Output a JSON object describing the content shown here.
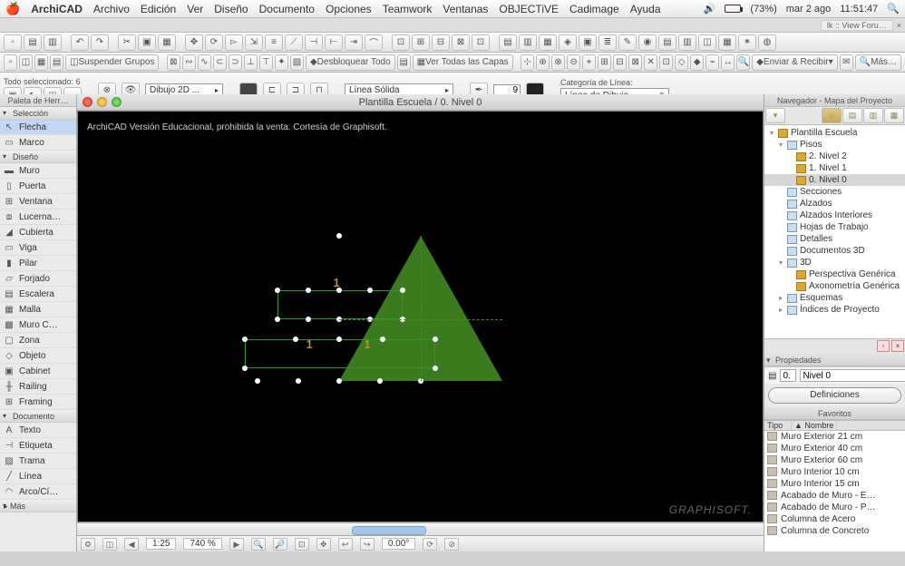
{
  "menubar": {
    "app": "ArchiCAD",
    "items": [
      "Archivo",
      "Edición",
      "Ver",
      "Diseño",
      "Documento",
      "Opciones",
      "Teamwork",
      "Ventanas",
      "OBJECTiVE",
      "Cadimage",
      "Ayuda"
    ],
    "battery_pct": "(73%)",
    "date": "mar 2 ago",
    "time": "11:51:47"
  },
  "tab_bar": {
    "tab1": "lk :: View Foru…"
  },
  "toolbar2": {
    "suspend": "Suspender Grupos",
    "unlock": "Desbloquear Todo",
    "show_layers": "Ver Todas las Capas",
    "send_recv": "Enviar & Recibir",
    "more": "Más…"
  },
  "infobox": {
    "sel_label": "Todo seleccionado:",
    "sel_count": "6",
    "layer": "Dibujo 2D ...",
    "line_type": "Línea Sólida",
    "pen": "9",
    "cat_label": "Categoría de Línea:",
    "cat_value": "Línea de Dibujo"
  },
  "toolbox": {
    "title": "Paleta de Herr…",
    "sec_sel": "Selección",
    "arrow": "Flecha",
    "marquee": "Marco",
    "sec_design": "Diseño",
    "tools_design": [
      "Muro",
      "Puerta",
      "Ventana",
      "Lucerna…",
      "Cubierta",
      "Viga",
      "Pilar",
      "Forjado",
      "Escalera",
      "Malla",
      "Muro C…",
      "Zona",
      "Objeto",
      "Cabinet",
      "Railing",
      "Framing"
    ],
    "sec_doc": "Documento",
    "tools_doc": [
      "Texto",
      "Etiqueta",
      "Trama",
      "Línea",
      "Arco/Cí…"
    ],
    "more": "Más"
  },
  "window": {
    "title": "Plantilla Escuela / 0. Nivel 0",
    "edu_note": "ArchiCAD Versión Educacional, prohibida la venta. Cortesía de Graphisoft.",
    "logo": "GRAPHISOFT."
  },
  "triangle": {
    "n1": "1",
    "n2": "1",
    "n3": "1"
  },
  "statusbar": {
    "scale": "1:25",
    "zoom": "740 %",
    "angle": "0.00°"
  },
  "navigator": {
    "title": "Navegador - Mapa del Proyecto",
    "root": "Plantilla Escuela",
    "pisos": "Pisos",
    "levels": [
      "2. Nivel 2",
      "1. Nivel 1",
      "0. Nivel 0"
    ],
    "secciones": "Secciones",
    "alzados": "Alzados",
    "alz_int": "Alzados Interiores",
    "hojas": "Hojas de Trabajo",
    "detalles": "Detalles",
    "doc3d": "Documentos 3D",
    "3d": "3D",
    "persp": "Perspectiva Genérica",
    "axo": "Axonometría Genérica",
    "esquemas": "Esquemas",
    "indices": "Índices de Proyecto"
  },
  "props": {
    "title": "Propiedades",
    "num": "0.",
    "name": "Nivel 0",
    "defs": "Definiciones"
  },
  "favorites": {
    "title": "Favoritos",
    "col1": "Tipo",
    "col2": "▲ Nombre",
    "items": [
      "Muro Exterior 21 cm",
      "Muro Exterior 40 cm",
      "Muro Exterior 60 cm",
      "Muro Interior 10 cm",
      "Muro Interior 15 cm",
      "Acabado de Muro - E…",
      "Acabado de Muro - P…",
      "Columna de Acero",
      "Columna de Concreto"
    ]
  }
}
